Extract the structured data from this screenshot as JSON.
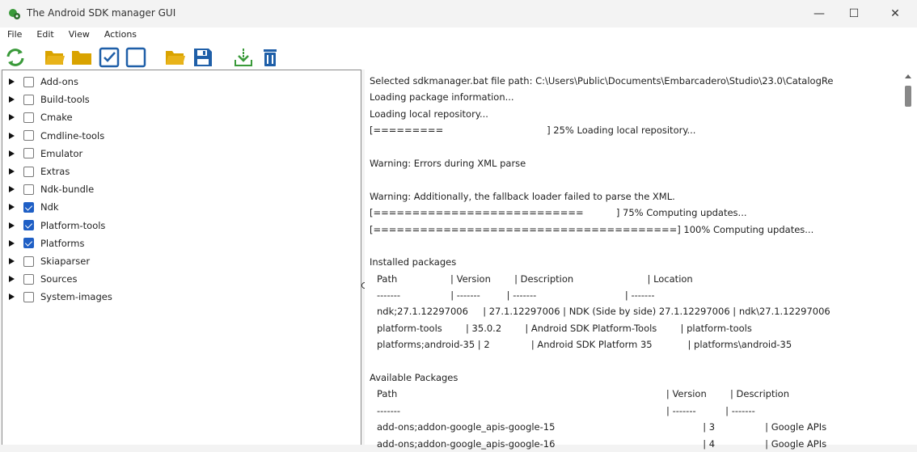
{
  "window": {
    "title": "The Android SDK manager GUI",
    "minimize": "—",
    "maximize": "☐",
    "close": "✕"
  },
  "menu": [
    "File",
    "Edit",
    "View",
    "Actions"
  ],
  "toolbar": [
    {
      "icon": "refresh-icon"
    },
    {
      "icon": "folder-open-icon"
    },
    {
      "icon": "folder-icon"
    },
    {
      "icon": "check-all-icon"
    },
    {
      "icon": "uncheck-all-icon"
    },
    {
      "icon": "open-file-icon"
    },
    {
      "icon": "save-icon"
    },
    {
      "icon": "download-icon"
    },
    {
      "icon": "delete-icon"
    }
  ],
  "colors": {
    "folder": "#d9a300",
    "blue": "#1f5fa8",
    "green": "#3a9a3a"
  },
  "tree": [
    {
      "label": "Add-ons",
      "checked": false
    },
    {
      "label": "Build-tools",
      "checked": false
    },
    {
      "label": "Cmake",
      "checked": false
    },
    {
      "label": "Cmdline-tools",
      "checked": false
    },
    {
      "label": "Emulator",
      "checked": false
    },
    {
      "label": "Extras",
      "checked": false
    },
    {
      "label": "Ndk-bundle",
      "checked": false
    },
    {
      "label": "Ndk",
      "checked": true
    },
    {
      "label": "Platform-tools",
      "checked": true
    },
    {
      "label": "Platforms",
      "checked": true
    },
    {
      "label": "Skiaparser",
      "checked": false
    },
    {
      "label": "Sources",
      "checked": false
    },
    {
      "label": "System-images",
      "checked": false
    }
  ],
  "log": [
    {
      "t": "Selected sdkmanager.bat file path: C:\\Users\\Public\\Documents\\Embarcadero\\Studio\\23.0\\CatalogRe"
    },
    {
      "t": "Loading package information..."
    },
    {
      "t": "Loading local repository..."
    },
    {
      "t": "[=========                                   ] 25% Loading local repository..."
    },
    {
      "t": ""
    },
    {
      "t": "Warning: Errors during XML parse"
    },
    {
      "t": ""
    },
    {
      "t": "Warning: Additionally, the fallback loader failed to parse the XML."
    },
    {
      "t": "[===========================           ] 75% Computing updates..."
    },
    {
      "t": "[=======================================] 100% Computing updates..."
    },
    {
      "t": ""
    },
    {
      "t": "Installed packages"
    },
    {
      "t": "Path                  | Version        | Description                         | Location",
      "i": 1
    },
    {
      "t": "-------                 | -------         | -------                              | -------",
      "i": 1
    },
    {
      "t": "ndk;27.1.12297006     | 27.1.12297006 | NDK (Side by side) 27.1.12297006 | ndk\\27.1.12297006",
      "i": 1
    },
    {
      "t": "platform-tools        | 35.0.2        | Android SDK Platform-Tools        | platform-tools",
      "i": 1
    },
    {
      "t": "platforms;android-35 | 2              | Android SDK Platform 35            | platforms\\android-35",
      "i": 1
    },
    {
      "t": ""
    },
    {
      "t": "Available Packages"
    },
    {
      "t": "Path                                                                                           | Version        | Description",
      "i": 1
    },
    {
      "t": "-------                                                                                          | -------          | -------",
      "i": 1
    },
    {
      "t": "add-ons;addon-google_apis-google-15                                                  | 3                 | Google APIs",
      "i": 1
    },
    {
      "t": "add-ons;addon-google_apis-google-16                                                  | 4                 | Google APIs",
      "i": 1
    }
  ]
}
